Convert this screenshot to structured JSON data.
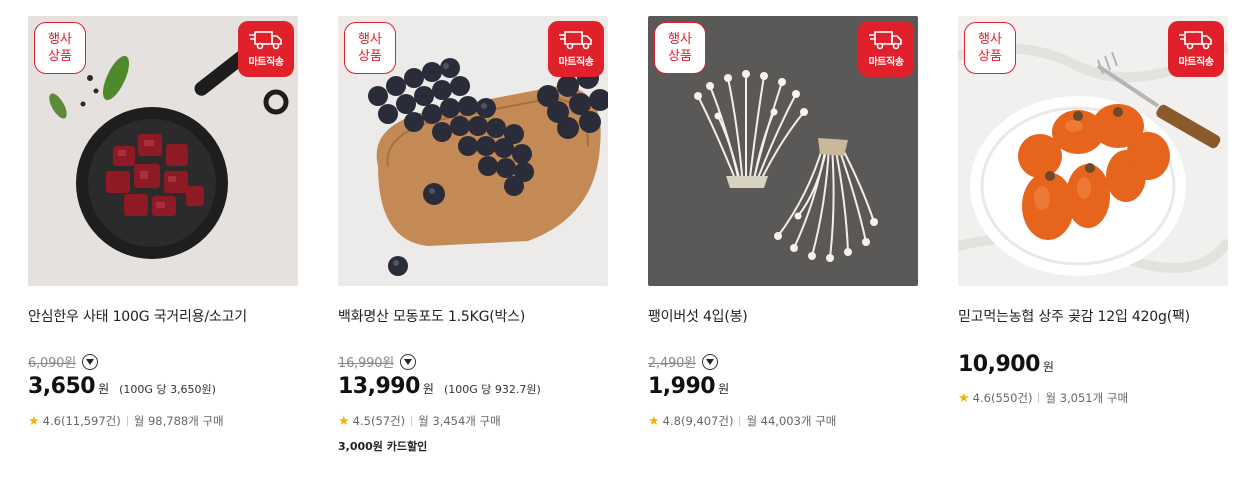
{
  "products": [
    {
      "event_badge_line1": "행사",
      "event_badge_line2": "상품",
      "mart_badge": "마트직송",
      "title": "안심한우 사태 100G 국거리용/소고기",
      "original_price": "6,090원",
      "price": "3,650",
      "currency": "원",
      "unit_price": "(100G 당 3,650원)",
      "rating": "4.6",
      "review_count": "(11,597건)",
      "monthly_purchases": "월 98,788개 구매",
      "card_discount": ""
    },
    {
      "event_badge_line1": "행사",
      "event_badge_line2": "상품",
      "mart_badge": "마트직송",
      "title": "백화명산 모동포도 1.5KG(박스)",
      "original_price": "16,990원",
      "price": "13,990",
      "currency": "원",
      "unit_price": "(100G 당 932.7원)",
      "rating": "4.5",
      "review_count": "(57건)",
      "monthly_purchases": "월 3,454개 구매",
      "card_discount": "3,000원 카드할인"
    },
    {
      "event_badge_line1": "행사",
      "event_badge_line2": "상품",
      "mart_badge": "마트직송",
      "title": "팽이버섯 4입(봉)",
      "original_price": "2,490원",
      "price": "1,990",
      "currency": "원",
      "unit_price": "",
      "rating": "4.8",
      "review_count": "(9,407건)",
      "monthly_purchases": "월 44,003개 구매",
      "card_discount": ""
    },
    {
      "event_badge_line1": "행사",
      "event_badge_line2": "상품",
      "mart_badge": "마트직송",
      "title": "믿고먹는농협 상주 곶감 12입 420g(팩)",
      "original_price": "",
      "price": "10,900",
      "currency": "원",
      "unit_price": "",
      "rating": "4.6",
      "review_count": "(550건)",
      "monthly_purchases": "월 3,051개 구매",
      "card_discount": ""
    }
  ],
  "icons": {
    "mart_badge_icon": "delivery-truck-icon",
    "price_toggle_icon": "chevron-down-icon",
    "rating_icon": "star-icon"
  },
  "colors": {
    "badge_red": "#e0202a",
    "star": "#f5b400"
  }
}
